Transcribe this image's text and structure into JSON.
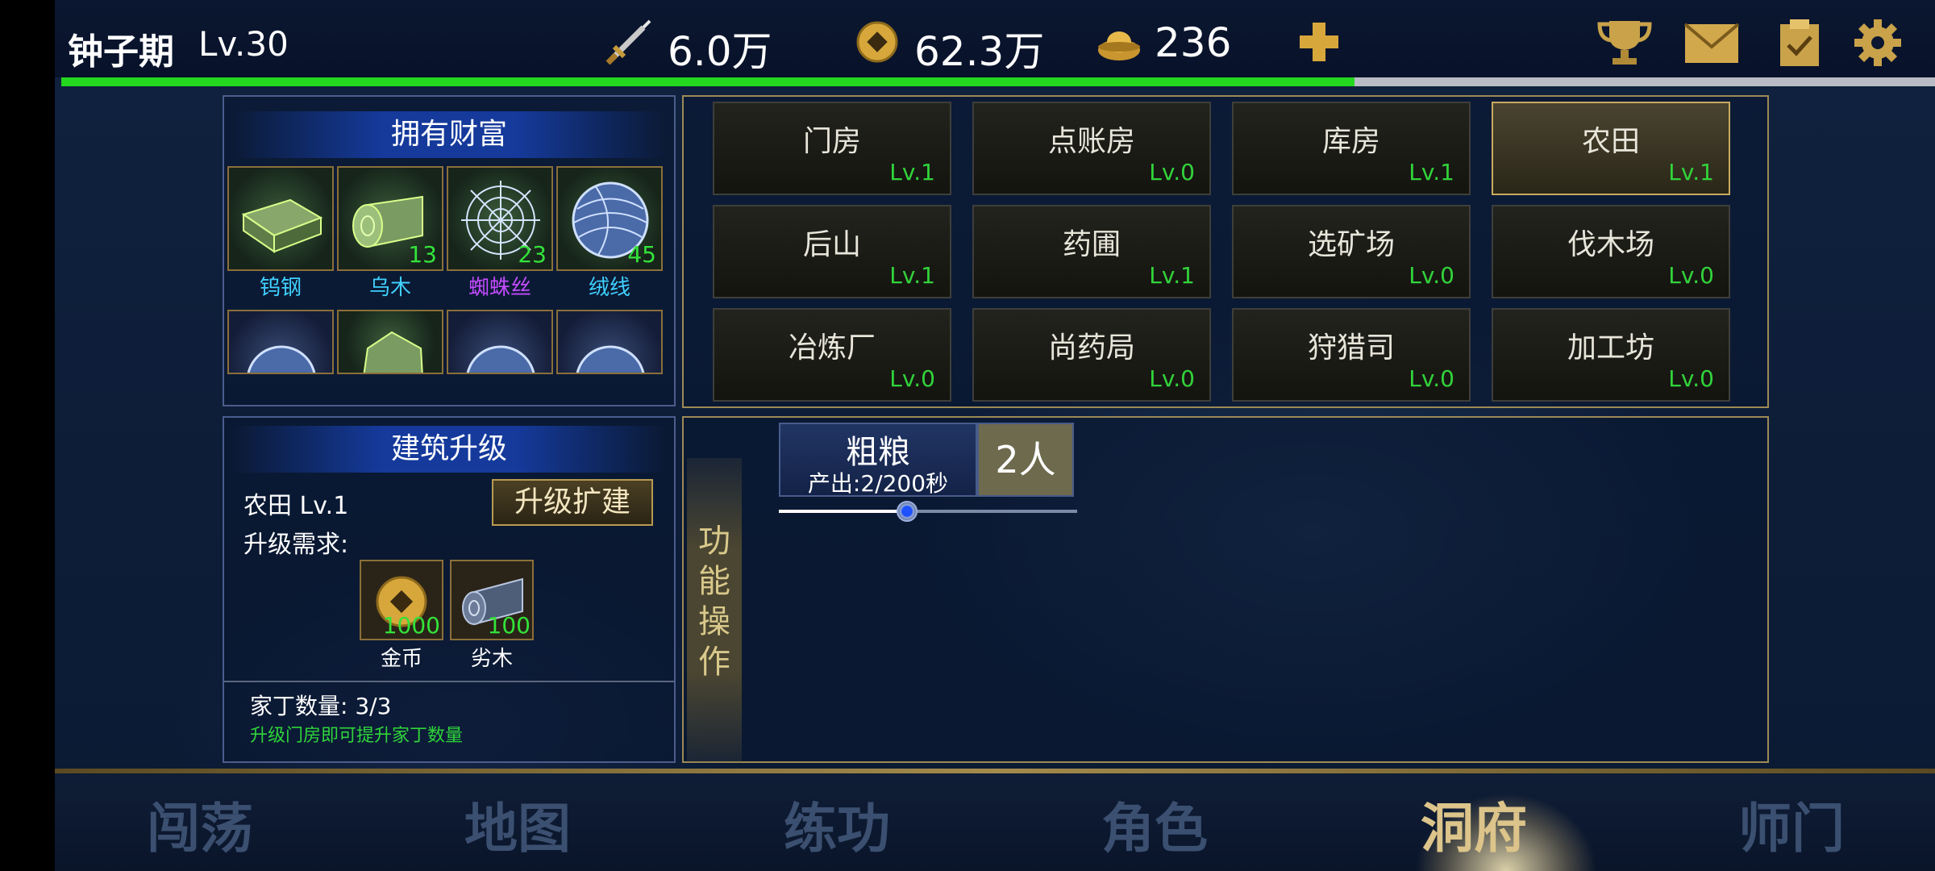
{
  "player": {
    "realm": "钟子期",
    "level": "Lv.30",
    "exp_fraction": 0.69
  },
  "stats": {
    "attack": "6.0万",
    "coins": "62.3万",
    "ingots": "236"
  },
  "colors": {
    "exp_bar": "#23d81f",
    "level_text": "#31d33a",
    "accent_gold": "#c9aa5e"
  },
  "wealth": {
    "title": "拥有财富",
    "items": [
      {
        "name": "钨钢",
        "count": "",
        "color": "#3fd0ff",
        "icon": "tungsten-ingot-icon"
      },
      {
        "name": "乌木",
        "count": "13",
        "color": "#3fd0ff",
        "icon": "ebony-log-icon"
      },
      {
        "name": "蜘蛛丝",
        "count": "23",
        "color": "#c34bff",
        "icon": "spider-silk-icon"
      },
      {
        "name": "绒线",
        "count": "45",
        "color": "#3fd0ff",
        "icon": "yarn-ball-icon"
      }
    ]
  },
  "buildings": [
    {
      "name": "门房",
      "level": "Lv.1",
      "selected": false
    },
    {
      "name": "点账房",
      "level": "Lv.0",
      "selected": false
    },
    {
      "name": "库房",
      "level": "Lv.1",
      "selected": false
    },
    {
      "name": "农田",
      "level": "Lv.1",
      "selected": true
    },
    {
      "name": "后山",
      "level": "Lv.1",
      "selected": false
    },
    {
      "name": "药圃",
      "level": "Lv.1",
      "selected": false
    },
    {
      "name": "选矿场",
      "level": "Lv.0",
      "selected": false
    },
    {
      "name": "伐木场",
      "level": "Lv.0",
      "selected": false
    },
    {
      "name": "冶炼厂",
      "level": "Lv.0",
      "selected": false
    },
    {
      "name": "尚药局",
      "level": "Lv.0",
      "selected": false
    },
    {
      "name": "狩猎司",
      "level": "Lv.0",
      "selected": false
    },
    {
      "name": "加工坊",
      "level": "Lv.0",
      "selected": false
    }
  ],
  "upgrade": {
    "title": "建筑升级",
    "building": "农田 Lv.1",
    "button": "升级扩建",
    "requirement_label": "升级需求:",
    "requirements": [
      {
        "name": "金币",
        "amount": "1000",
        "icon": "coin-icon"
      },
      {
        "name": "劣木",
        "amount": "100",
        "icon": "wood-log-icon"
      }
    ],
    "servants": "家丁数量: 3/3",
    "hint": "升级门房即可提升家丁数量"
  },
  "function": {
    "tab_chars": [
      "功",
      "能",
      "操",
      "作"
    ],
    "product": "粗粮",
    "output": "产出:2/200秒",
    "workers": "2人",
    "slider_fraction": 0.43
  },
  "nav": [
    {
      "label": "闯荡",
      "active": false
    },
    {
      "label": "地图",
      "active": false
    },
    {
      "label": "练功",
      "active": false
    },
    {
      "label": "角色",
      "active": false
    },
    {
      "label": "洞府",
      "active": true
    },
    {
      "label": "师门",
      "active": false
    }
  ]
}
